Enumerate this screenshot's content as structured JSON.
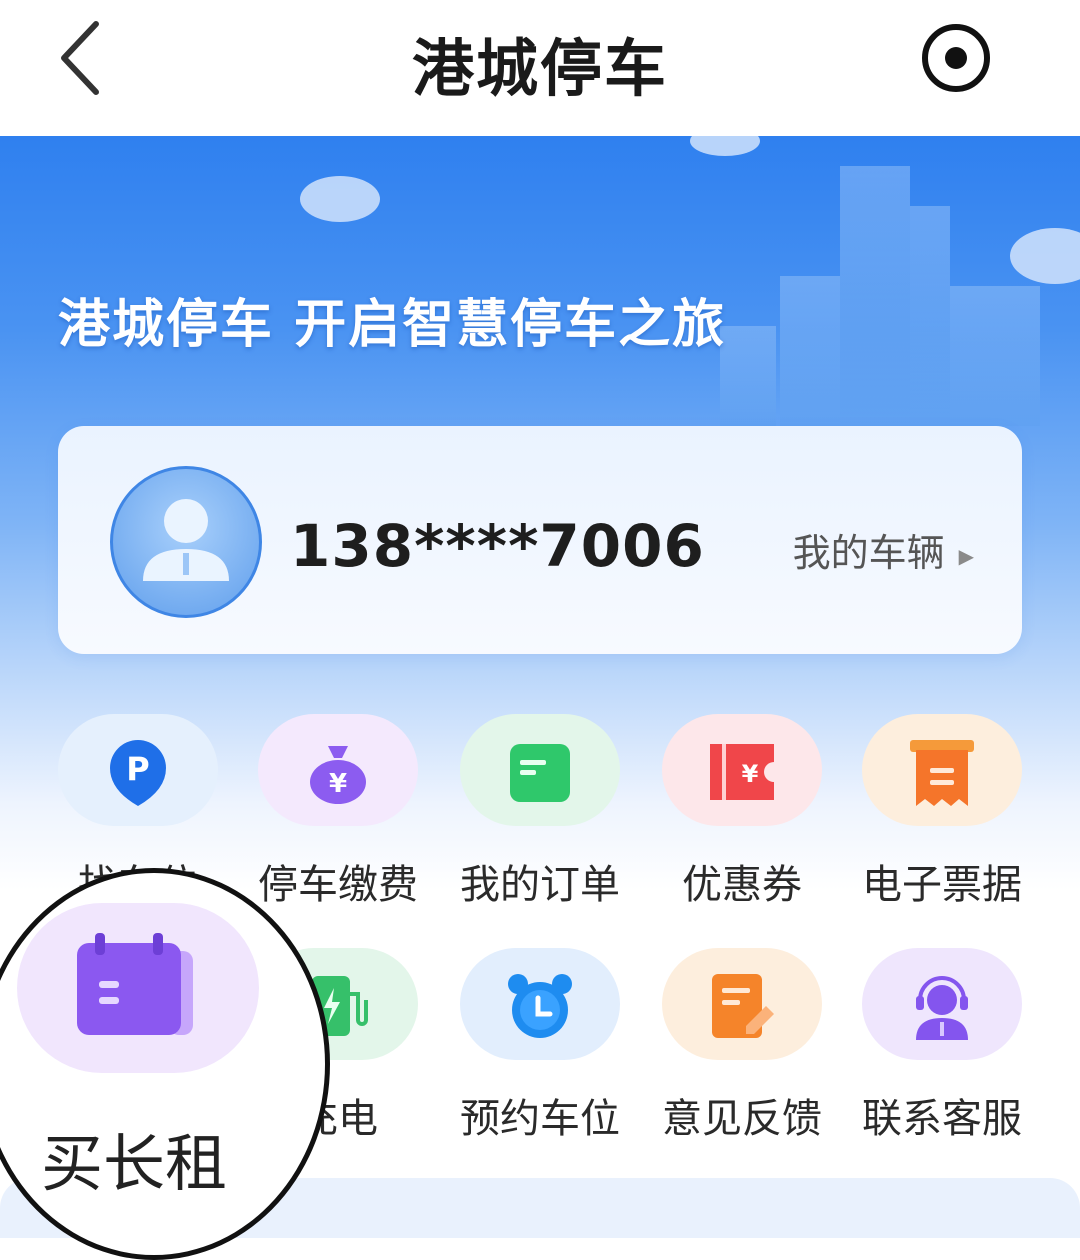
{
  "header": {
    "title": "港城停车",
    "back_icon": "chevron-left-icon",
    "action_icon": "target-icon"
  },
  "hero": {
    "slogan": "港城停车 开启智慧停车之旅"
  },
  "user_card": {
    "phone": "138****7006",
    "my_vehicles_label": "我的车辆",
    "avatar_icon": "user-avatar-icon"
  },
  "grid": {
    "items": [
      {
        "label": "找车位",
        "icon": "parking-pin-icon",
        "color": "#1f6fe8"
      },
      {
        "label": "停车缴费",
        "icon": "money-bag-icon",
        "color": "#8c5cf0"
      },
      {
        "label": "我的订单",
        "icon": "order-card-icon",
        "color": "#2fc86b"
      },
      {
        "label": "优惠券",
        "icon": "coupon-icon",
        "color": "#f0464a"
      },
      {
        "label": "电子票据",
        "icon": "receipt-icon",
        "color": "#f5752a"
      },
      {
        "label": "买长租",
        "icon": "calendar-icon",
        "color": "#8b58f0"
      },
      {
        "label": "充电",
        "icon": "charging-station-icon",
        "color": "#36c06a"
      },
      {
        "label": "预约车位",
        "icon": "alarm-clock-icon",
        "color": "#1e8cf0"
      },
      {
        "label": "意见反馈",
        "icon": "feedback-edit-icon",
        "color": "#f5842a"
      },
      {
        "label": "联系客服",
        "icon": "customer-service-icon",
        "color": "#8455ee"
      }
    ]
  }
}
